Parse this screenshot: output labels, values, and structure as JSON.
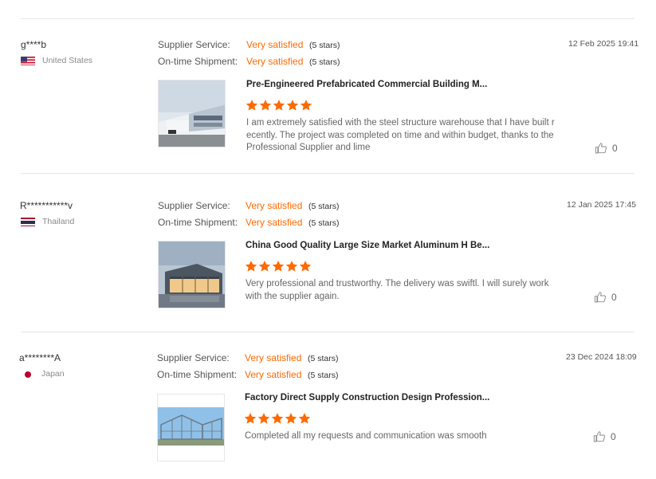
{
  "labels": {
    "supplier_service": "Supplier Service:",
    "ontime_shipment": "On-time Shipment:"
  },
  "colors": {
    "accent": "#ff6a00",
    "divider": "#e6e6e6"
  },
  "reviews": [
    {
      "user": "g****b",
      "country": "United States",
      "flag_icon": "us-flag-icon",
      "supplier_service": "Very satisfied",
      "supplier_service_stars": "(5 stars)",
      "ontime_shipment": "Very satisfied",
      "ontime_shipment_stars": "(5 stars)",
      "date": "12 Feb 2025 19:41",
      "product_title": "Pre-Engineered Prefabricated Commercial Building M...",
      "rating": 5,
      "comment": "I am extremely satisfied with the steel structure warehouse that I have built recently. The project was completed on time and within budget, thanks to the Professional Supplier and lime",
      "likes": "0"
    },
    {
      "user": "R***********v",
      "country": "Thailand",
      "flag_icon": "thailand-flag-icon",
      "supplier_service": "Very satisfied",
      "supplier_service_stars": "(5 stars)",
      "ontime_shipment": "Very satisfied",
      "ontime_shipment_stars": "(5 stars)",
      "date": "12 Jan 2025 17:45",
      "product_title": "China Good Quality Large Size Market Aluminum H Be...",
      "rating": 5,
      "comment": "Very professional and trustworthy. The delivery was swiftl. I will surely work with the supplier again.",
      "likes": "0"
    },
    {
      "user": "a********A",
      "country": "Japan",
      "flag_icon": "japan-flag-icon",
      "supplier_service": "Very satisfied",
      "supplier_service_stars": "(5 stars)",
      "ontime_shipment": "Very satisfied",
      "ontime_shipment_stars": "(5 stars)",
      "date": "23 Dec 2024 18:09",
      "product_title": "Factory Direct Supply Construction Design Profession...",
      "rating": 5,
      "comment": "Completed all my requests and communication was smooth",
      "likes": "0"
    }
  ]
}
